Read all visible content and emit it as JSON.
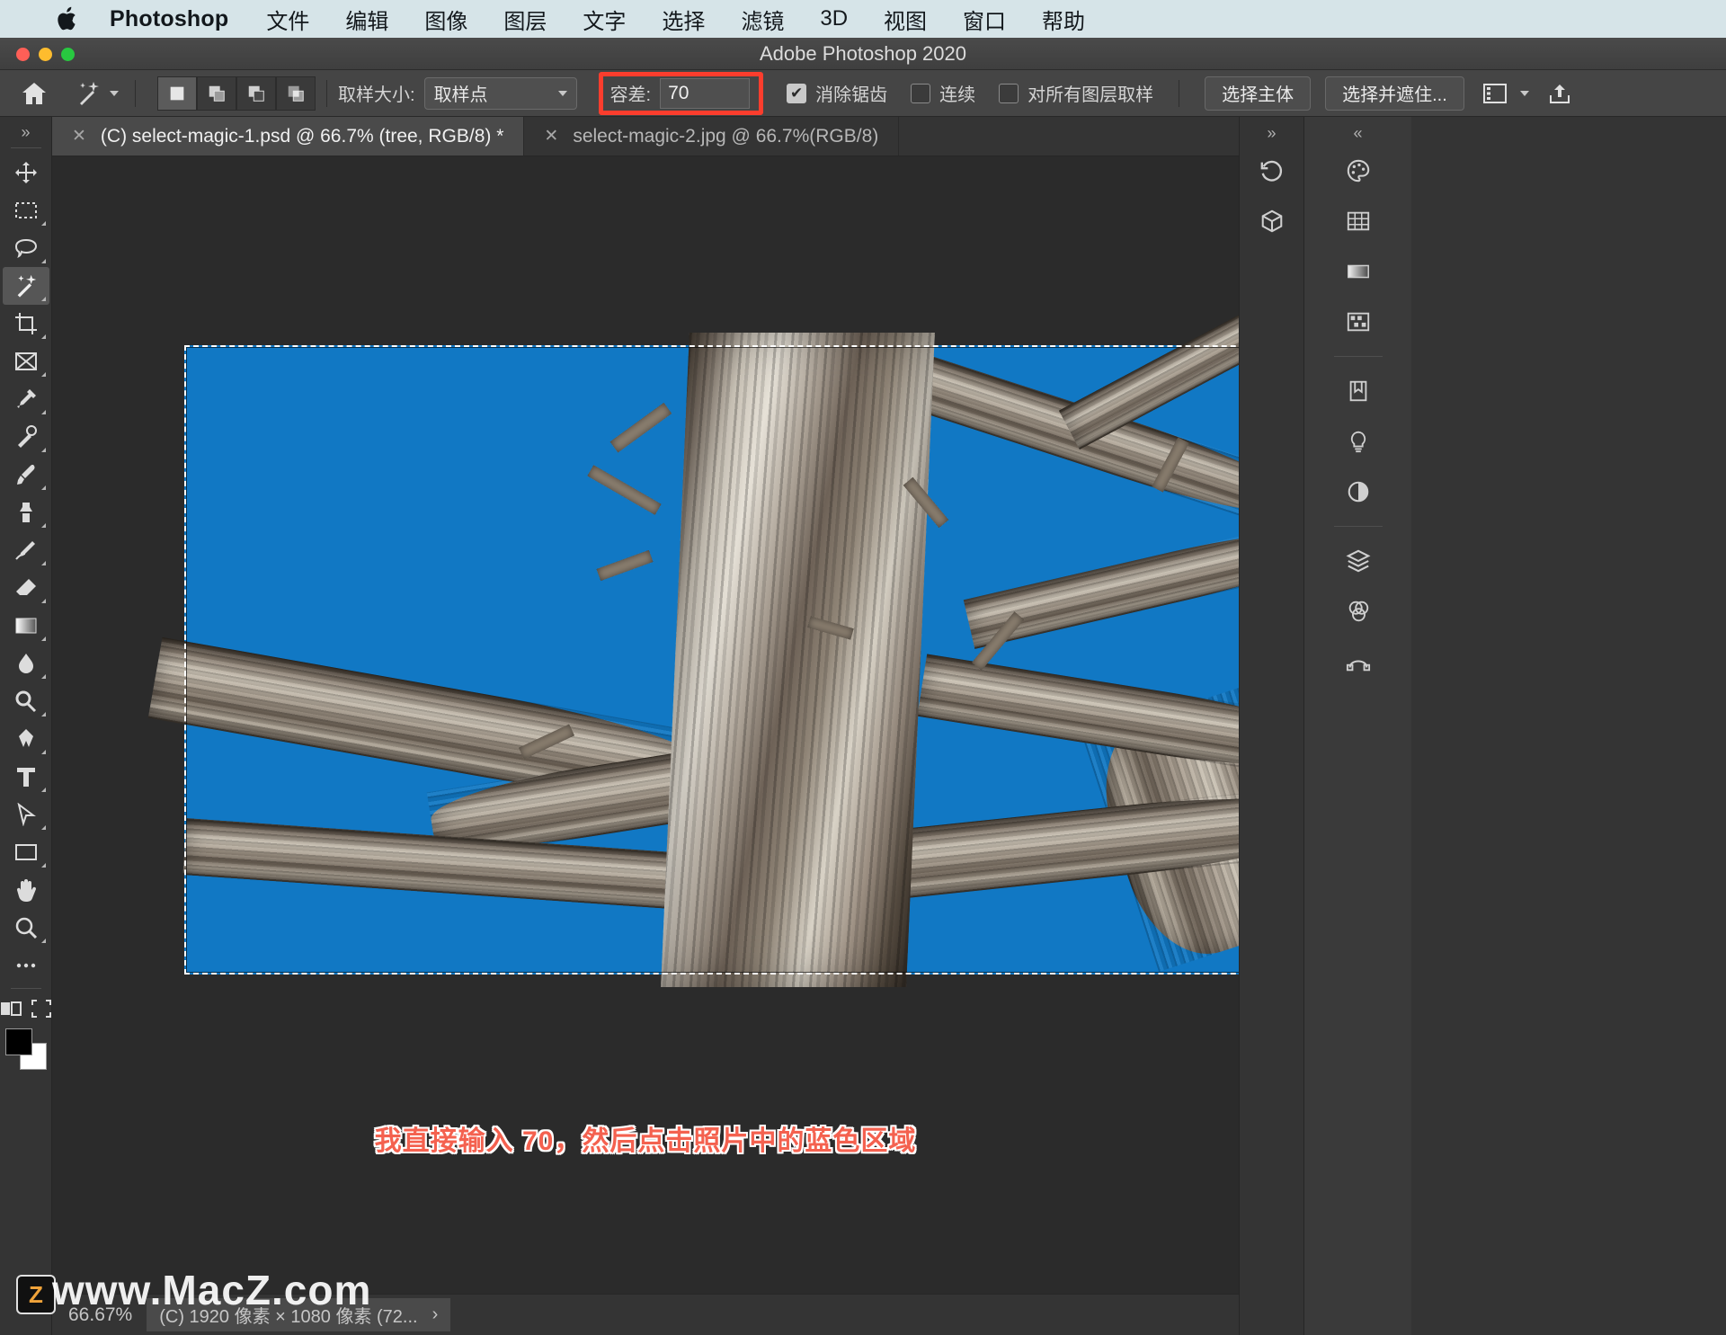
{
  "macbar": {
    "apple_icon": "apple-logo-icon",
    "app_name": "Photoshop",
    "menus": [
      "文件",
      "编辑",
      "图像",
      "图层",
      "文字",
      "选择",
      "滤镜",
      "3D",
      "视图",
      "窗口",
      "帮助"
    ]
  },
  "window": {
    "title": "Adobe Photoshop 2020"
  },
  "options_bar": {
    "home_icon": "home-icon",
    "tool_icon": "magic-wand-icon",
    "tool_dropdown_icon": "chevron-down-icon",
    "selection_modes": [
      {
        "name": "new-selection",
        "icon": "square-icon",
        "active": true
      },
      {
        "name": "add-to-selection",
        "icon": "add-square-icon",
        "active": false
      },
      {
        "name": "subtract-from-selection",
        "icon": "subtract-square-icon",
        "active": false
      },
      {
        "name": "intersect-selection",
        "icon": "intersect-square-icon",
        "active": false
      }
    ],
    "sample_size_label": "取样大小:",
    "sample_size_value": "取样点",
    "tolerance_label": "容差:",
    "tolerance_value": "70",
    "tolerance_highlight_color": "#fc3d2d",
    "antialias_label": "消除锯齿",
    "antialias_checked": true,
    "contiguous_label": "连续",
    "contiguous_checked": false,
    "sample_all_layers_label": "对所有图层取样",
    "sample_all_layers_checked": false,
    "select_subject_label": "选择主体",
    "select_and_mask_label": "选择并遮住...",
    "workspace_icon": "workspace-switcher-icon",
    "workspace_chevron_icon": "chevron-down-icon",
    "share_icon": "share-upload-icon"
  },
  "tabs": [
    {
      "close_icon": "close-icon",
      "label": "(C) select-magic-1.psd @ 66.7% (tree, RGB/8) *",
      "active": true
    },
    {
      "close_icon": "close-icon",
      "label": "select-magic-2.jpg @ 66.7%(RGB/8)",
      "active": false
    }
  ],
  "toolbar": {
    "collapse_icon": "double-chevron-right-icon",
    "tools": [
      {
        "name": "move-tool",
        "icon": "move-icon",
        "selected": false
      },
      {
        "name": "rectangular-marquee-tool",
        "icon": "marquee-rect-icon",
        "selected": false
      },
      {
        "name": "lasso-tool",
        "icon": "lasso-icon",
        "selected": false
      },
      {
        "name": "magic-wand-tool",
        "icon": "magic-wand-icon",
        "selected": true
      },
      {
        "name": "crop-tool",
        "icon": "crop-icon",
        "selected": false
      },
      {
        "name": "frame-tool",
        "icon": "frame-icon",
        "selected": false
      },
      {
        "name": "eyedropper-tool",
        "icon": "eyedropper-icon",
        "selected": false
      },
      {
        "name": "spot-healing-brush-tool",
        "icon": "healing-brush-icon",
        "selected": false
      },
      {
        "name": "brush-tool",
        "icon": "brush-icon",
        "selected": false
      },
      {
        "name": "clone-stamp-tool",
        "icon": "clone-stamp-icon",
        "selected": false
      },
      {
        "name": "history-brush-tool",
        "icon": "history-brush-icon",
        "selected": false
      },
      {
        "name": "eraser-tool",
        "icon": "eraser-icon",
        "selected": false
      },
      {
        "name": "gradient-tool",
        "icon": "gradient-icon",
        "selected": false
      },
      {
        "name": "blur-tool",
        "icon": "blur-drop-icon",
        "selected": false
      },
      {
        "name": "dodge-tool",
        "icon": "dodge-icon",
        "selected": false
      },
      {
        "name": "pen-tool",
        "icon": "pen-icon",
        "selected": false
      },
      {
        "name": "type-tool",
        "icon": "type-t-icon",
        "selected": false
      },
      {
        "name": "path-selection-tool",
        "icon": "path-arrow-icon",
        "selected": false
      },
      {
        "name": "rectangle-tool",
        "icon": "rectangle-icon",
        "selected": false
      },
      {
        "name": "hand-tool",
        "icon": "hand-icon",
        "selected": false
      },
      {
        "name": "zoom-tool",
        "icon": "zoom-magnifier-icon",
        "selected": false
      },
      {
        "name": "edit-toolbar",
        "icon": "ellipsis-icon",
        "selected": false
      }
    ],
    "quickmask_icon": "quick-mask-icon",
    "screenmode_icon": "screen-mode-icon",
    "foreground_color": "#000000",
    "background_color": "#ffffff"
  },
  "canvas": {
    "sky_color": "#1178c4",
    "annotation": "我直接输入 70，然后点击照片中的蓝色区域",
    "annotation_color": "#f4614f",
    "selection_active": true
  },
  "right_panels": {
    "collapse_icon": "double-chevron-right-icon",
    "rail_a": [
      {
        "name": "history-panel-icon",
        "icon": "history-icon"
      },
      {
        "name": "3d-panel-icon",
        "icon": "cube-icon"
      }
    ],
    "rail_b": [
      {
        "name": "color-panel-icon",
        "icon": "palette-icon"
      },
      {
        "name": "swatches-panel-icon",
        "icon": "grid-swatches-icon"
      },
      {
        "name": "gradients-panel-icon",
        "icon": "gradient-bar-icon"
      },
      {
        "name": "patterns-panel-icon",
        "icon": "pattern-grid-icon"
      },
      {
        "name": "adjustments-panel-icon",
        "icon": "bookmark-icon"
      },
      {
        "name": "styles-panel-icon",
        "icon": "lightbulb-icon"
      },
      {
        "name": "properties-panel-icon",
        "icon": "half-circle-icon"
      },
      {
        "name": "layers-panel-icon",
        "icon": "layers-icon"
      },
      {
        "name": "channels-panel-icon",
        "icon": "channels-circles-icon"
      },
      {
        "name": "paths-panel-icon",
        "icon": "paths-node-icon"
      }
    ]
  },
  "statusbar": {
    "zoom_level": "66.67%",
    "doc_info": "(C) 1920 像素 × 1080 像素 (72...",
    "expand_icon": "chevron-right-icon"
  },
  "watermark": {
    "text": "www.MacZ.com",
    "badge": "Z"
  }
}
